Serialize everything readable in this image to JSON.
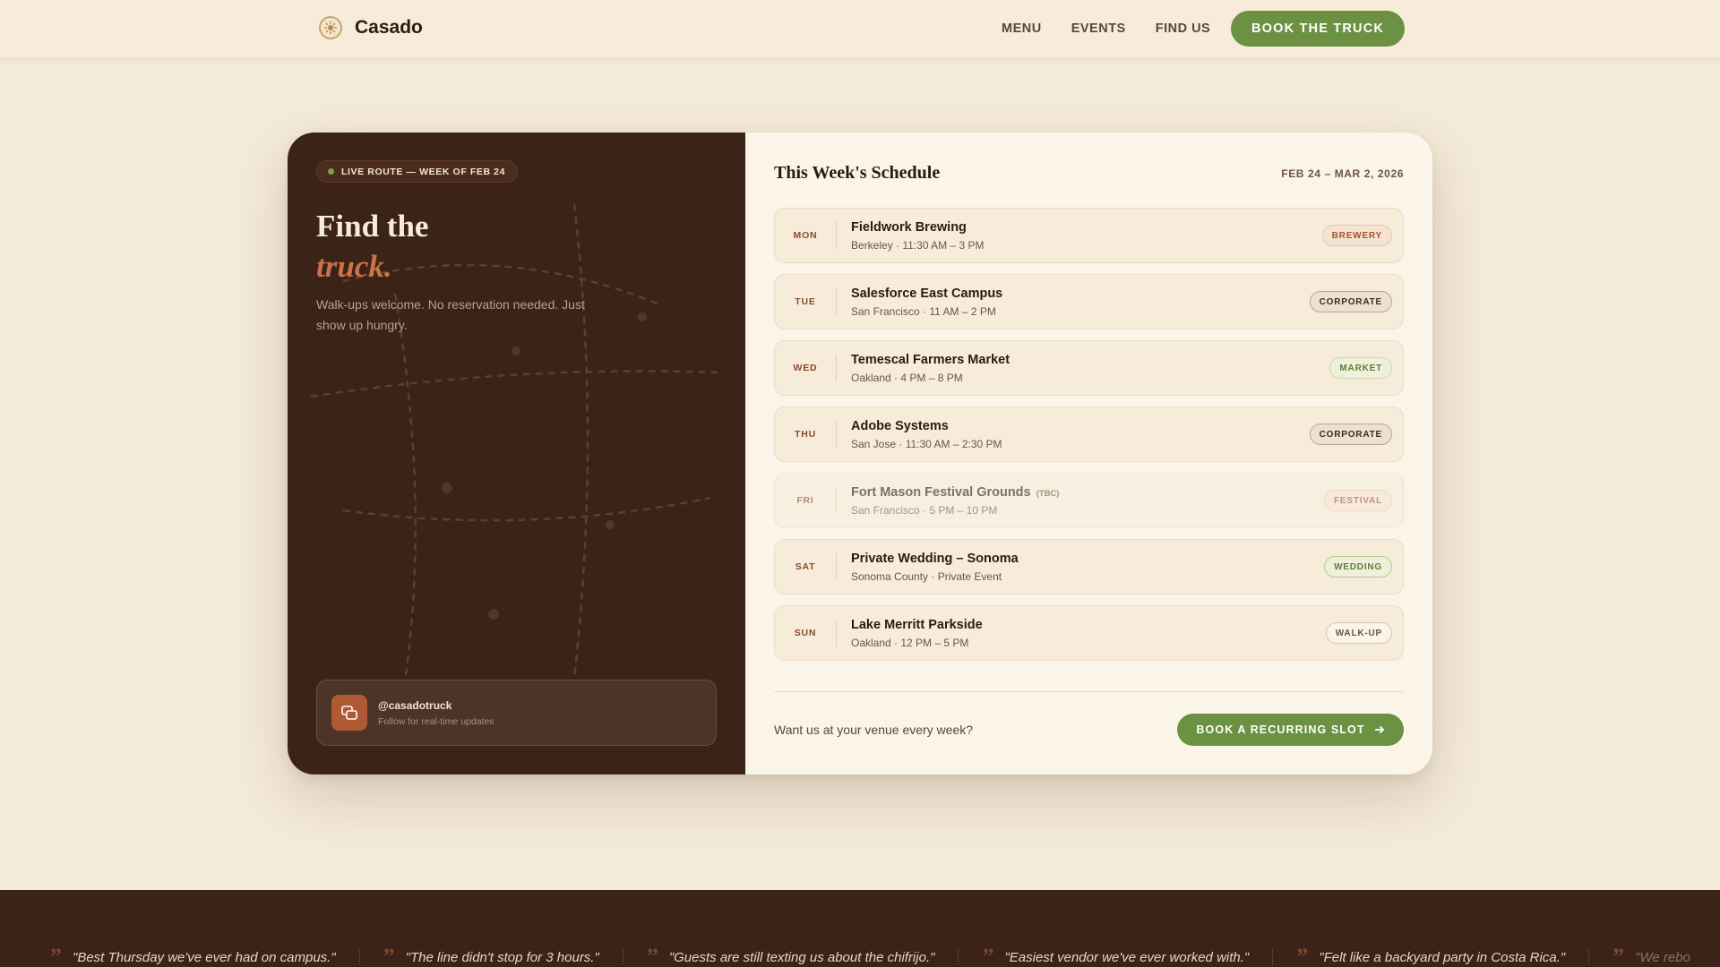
{
  "nav": {
    "brand": "Casado",
    "links": [
      "MENU",
      "EVENTS",
      "FIND US"
    ],
    "cta": "BOOK THE TRUCK"
  },
  "hero": {
    "badge": "LIVE ROUTE — WEEK OF FEB 24",
    "title_line1": "Find the",
    "title_line2": "truck.",
    "subtitle": "Walk-ups welcome. No reservation needed. Just show up hungry.",
    "social_handle": "@casadotruck",
    "social_note": "Follow for real-time updates"
  },
  "schedule": {
    "title": "This Week's Schedule",
    "range": "FEB 24 – MAR 2, 2026",
    "rows": [
      {
        "day": "MON",
        "venue": "Fieldwork Brewing",
        "tbc": "",
        "meta": "Berkeley · 11:30 AM – 3 PM",
        "tag": "BREWERY"
      },
      {
        "day": "TUE",
        "venue": "Salesforce East Campus",
        "tbc": "",
        "meta": "San Francisco · 11 AM – 2 PM",
        "tag": "CORPORATE"
      },
      {
        "day": "WED",
        "venue": "Temescal Farmers Market",
        "tbc": "",
        "meta": "Oakland · 4 PM – 8 PM",
        "tag": "MARKET"
      },
      {
        "day": "THU",
        "venue": "Adobe Systems",
        "tbc": "",
        "meta": "San Jose · 11:30 AM – 2:30 PM",
        "tag": "CORPORATE"
      },
      {
        "day": "FRI",
        "venue": "Fort Mason Festival Grounds",
        "tbc": "(TBC)",
        "meta": "San Francisco · 5 PM – 10 PM",
        "tag": "FESTIVAL"
      },
      {
        "day": "SAT",
        "venue": "Private Wedding – Sonoma",
        "tbc": "",
        "meta": "Sonoma County · Private Event",
        "tag": "WEDDING"
      },
      {
        "day": "SUN",
        "venue": "Lake Merritt Parkside",
        "tbc": "",
        "meta": "Oakland · 12 PM – 5 PM",
        "tag": "WALK-UP"
      }
    ],
    "cta_text": "Want us at your venue every week?",
    "cta_button": "BOOK A RECURRING SLOT"
  },
  "testimonials": [
    "\"Best Thursday we've ever had on campus.\"",
    "\"The line didn't stop for 3 hours.\"",
    "\"Guests are still texting us about the chifrijo.\"",
    "\"Easiest vendor we've ever worked with.\"",
    "\"Felt like a backyard party in Costa Rica.\"",
    "\"We rebo"
  ],
  "colors": {
    "accent_green": "#6b9142",
    "dark_brown": "#3b2317",
    "terracotta": "#c8734a",
    "cream": "#f4ead8"
  },
  "icons": {
    "brand": "sun-emblem-icon",
    "social": "chat-bubbles-icon",
    "cta": "arrow-right-icon",
    "quote": "quote-mark-icon"
  }
}
